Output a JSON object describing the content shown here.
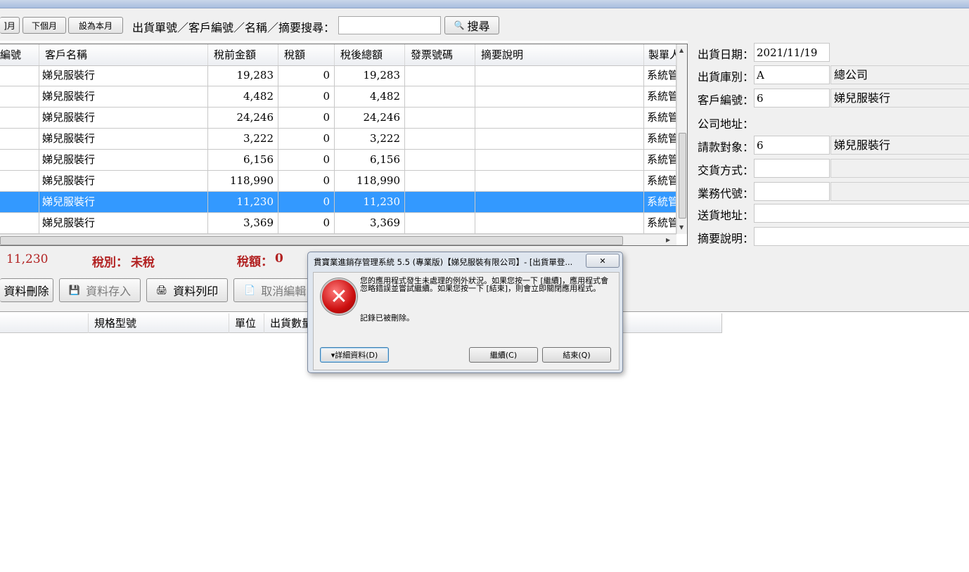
{
  "toolbar": {
    "month_btn_partial": "]月",
    "next_month": "下個月",
    "set_this_month": "設為本月",
    "search_label": "出貨單號／客戶編號／名稱／摘要搜尋：",
    "search_value": "",
    "search_btn": "搜尋"
  },
  "grid": {
    "columns": [
      "編號",
      "客戶名稱",
      "稅前金額",
      "稅額",
      "稅後總額",
      "發票號碼",
      "摘要說明",
      "製單人"
    ],
    "rows": [
      {
        "customer": "娣兒服裝行",
        "pretax": "19,283",
        "tax": "0",
        "total": "19,283",
        "invoice": "",
        "memo": "",
        "maker": "系統管"
      },
      {
        "customer": "娣兒服裝行",
        "pretax": "4,482",
        "tax": "0",
        "total": "4,482",
        "invoice": "",
        "memo": "",
        "maker": "系統管"
      },
      {
        "customer": "娣兒服裝行",
        "pretax": "24,246",
        "tax": "0",
        "total": "24,246",
        "invoice": "",
        "memo": "",
        "maker": "系統管"
      },
      {
        "customer": "娣兒服裝行",
        "pretax": "3,222",
        "tax": "0",
        "total": "3,222",
        "invoice": "",
        "memo": "",
        "maker": "系統管"
      },
      {
        "customer": "娣兒服裝行",
        "pretax": "6,156",
        "tax": "0",
        "total": "6,156",
        "invoice": "",
        "memo": "",
        "maker": "系統管"
      },
      {
        "customer": "娣兒服裝行",
        "pretax": "118,990",
        "tax": "0",
        "total": "118,990",
        "invoice": "",
        "memo": "",
        "maker": "系統管"
      },
      {
        "customer": "娣兒服裝行",
        "pretax": "11,230",
        "tax": "0",
        "total": "11,230",
        "invoice": "",
        "memo": "",
        "maker": "系統管"
      },
      {
        "customer": "娣兒服裝行",
        "pretax": "3,369",
        "tax": "0",
        "total": "3,369",
        "invoice": "",
        "memo": "",
        "maker": "系統管"
      }
    ],
    "selected_row": 6
  },
  "detail": {
    "ship_date_label": "出貨日期：",
    "ship_date": "2021/11/19",
    "warehouse_label": "出貨庫別：",
    "warehouse_code": "A",
    "warehouse_name": "總公司",
    "customer_no_label": "客戶編號：",
    "customer_no": "6",
    "customer_name": "娣兒服裝行",
    "company_addr_label": "公司地址：",
    "bill_to_label": "請款對象：",
    "bill_to_no": "6",
    "bill_to_name": "娣兒服裝行",
    "delivery_label": "交貨方式：",
    "delivery_value": "",
    "sales_label": "業務代號：",
    "sales_value": "",
    "ship_addr_label": "送貨地址：",
    "ship_addr": "",
    "memo_label": "摘要說明：",
    "memo": ""
  },
  "summary": {
    "amount": "11,230",
    "tax_type_label": "稅別：",
    "tax_type": "未稅",
    "tax_label": "稅額：",
    "tax_value": "0"
  },
  "actions": {
    "delete": "資料刪除",
    "save": "資料存入",
    "print": "資料列印",
    "cancel": "取消編輯"
  },
  "detail_grid": {
    "columns": [
      "規格型號",
      "單位",
      "出貨數量"
    ]
  },
  "dialog": {
    "title": "貫寶業進銷存管理系統 5.5 (專業版)【娣兒服裝有限公司】- [出貨單登...",
    "message": "您的應用程式發生未處理的例外狀況。如果您按一下 [繼續]，應用程式會忽略錯誤並嘗試繼續。如果您按一下 [結束]，則會立即關閉應用程式。",
    "detail_message": "記錄已被刪除。",
    "details_btn": "▾詳細資料(D)",
    "continue_btn": "繼續(C)",
    "quit_btn": "結束(Q)"
  }
}
